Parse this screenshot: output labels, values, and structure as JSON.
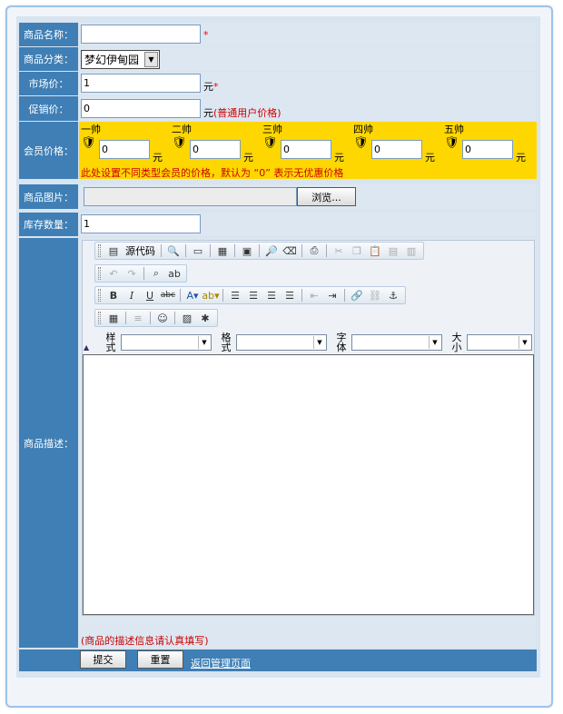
{
  "form": {
    "name": {
      "label": "商品名称：",
      "value": "",
      "required_mark": "*"
    },
    "category": {
      "label": "商品分类：",
      "selected": "梦幻伊甸园"
    },
    "market_price": {
      "label": "市场价：",
      "value": "1",
      "unit": "元",
      "required_mark": "*"
    },
    "promo_price": {
      "label": "促销价：",
      "value": "0",
      "unit": "元",
      "note": "(普通用户价格)"
    },
    "member_price": {
      "label": "会员价格：",
      "levels": [
        {
          "name": "一帅",
          "value": "0",
          "unit": "元"
        },
        {
          "name": "二帅",
          "value": "0",
          "unit": "元"
        },
        {
          "name": "三帅",
          "value": "0",
          "unit": "元"
        },
        {
          "name": "四帅",
          "value": "0",
          "unit": "元"
        },
        {
          "name": "五帅",
          "value": "0",
          "unit": "元"
        }
      ],
      "note": "此处设置不同类型会员的价格，默认为 “0” 表示无优惠价格"
    },
    "image": {
      "label": "商品图片：",
      "value": "",
      "browse_label": "浏览..."
    },
    "stock": {
      "label": "库存数量：",
      "value": "1"
    },
    "description": {
      "label": "商品描述：",
      "note": "(商品的描述信息请认真填写)",
      "editor": {
        "source_label": "源代码",
        "style_label": "样式",
        "format_label": "格式",
        "font_label": "字体",
        "size_label": "大小"
      }
    },
    "actions": {
      "submit": "提交",
      "reset": "重置",
      "back_link": "返回管理页面"
    }
  },
  "colors": {
    "label_bg": "#3f7fb5",
    "member_bg": "#ffd700",
    "required": "#ff0000"
  }
}
